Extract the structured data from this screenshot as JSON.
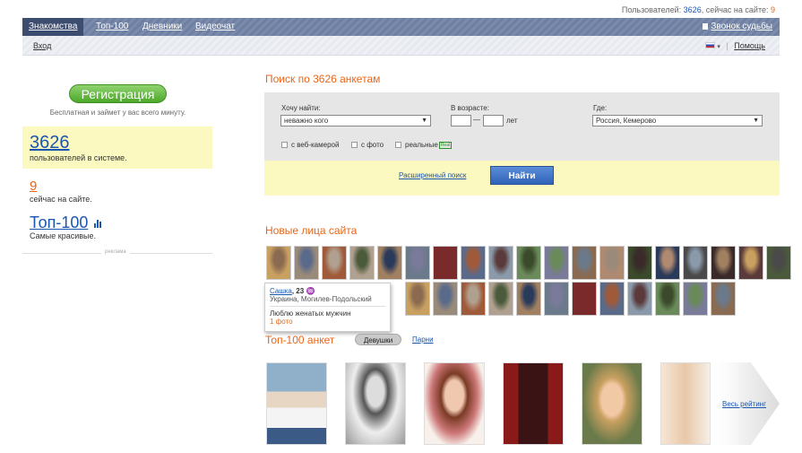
{
  "top_status": {
    "users_label": "Пользователей:",
    "users_count": "3626",
    "online_label": ", сейчас на сайте:",
    "online_count": "9"
  },
  "nav": {
    "tabs": [
      {
        "label": "Знакомства",
        "active": true
      },
      {
        "label": "Топ-100"
      },
      {
        "label": "Дневники"
      },
      {
        "label": "Видеочат"
      }
    ],
    "fate_call": "Звонок судьбы"
  },
  "subnav": {
    "login": "Вход",
    "help": "Помощь"
  },
  "sidebar": {
    "register_button": "Регистрация",
    "register_sub": "Бесплатная и займет у вас всего минуту.",
    "users_count": "3626",
    "users_label": "пользователей в системе.",
    "online_count": "9",
    "online_label": "сейчас на сайте.",
    "top100_title": "Топ-100",
    "top100_label": "Самые красивые.",
    "ad_label": "реклама"
  },
  "search": {
    "title": "Поиск по 3626 анкетам",
    "want_label": "Хочу найти:",
    "want_value": "неважно кого",
    "age_label": "В возрасте:",
    "age_dash": "—",
    "age_unit": "лет",
    "where_label": "Где:",
    "where_value": "Россия, Кемерово",
    "opt_webcam": "с веб-камерой",
    "opt_photo": "с фото",
    "opt_real": "реальные",
    "real_badge": "Real",
    "advanced_link": "Расширенный поиск",
    "find_button": "Найти"
  },
  "new_faces": {
    "title": "Новые лица сайта",
    "tooltip": {
      "name": "Сашка",
      "age": ", 23",
      "location": "Украина, Могилев-Подольский",
      "status": "Люблю женатых мужчин",
      "photos": "1 фото"
    }
  },
  "top100": {
    "title": "Топ-100 анкет",
    "girls": "Девушки",
    "boys": "Парни",
    "full_rating": "Весь рейтинг"
  },
  "colors": {
    "accent": "#e8651a",
    "link": "#1a56b0",
    "nav": "#6e7fa1",
    "highlight": "#fbf8c0"
  }
}
